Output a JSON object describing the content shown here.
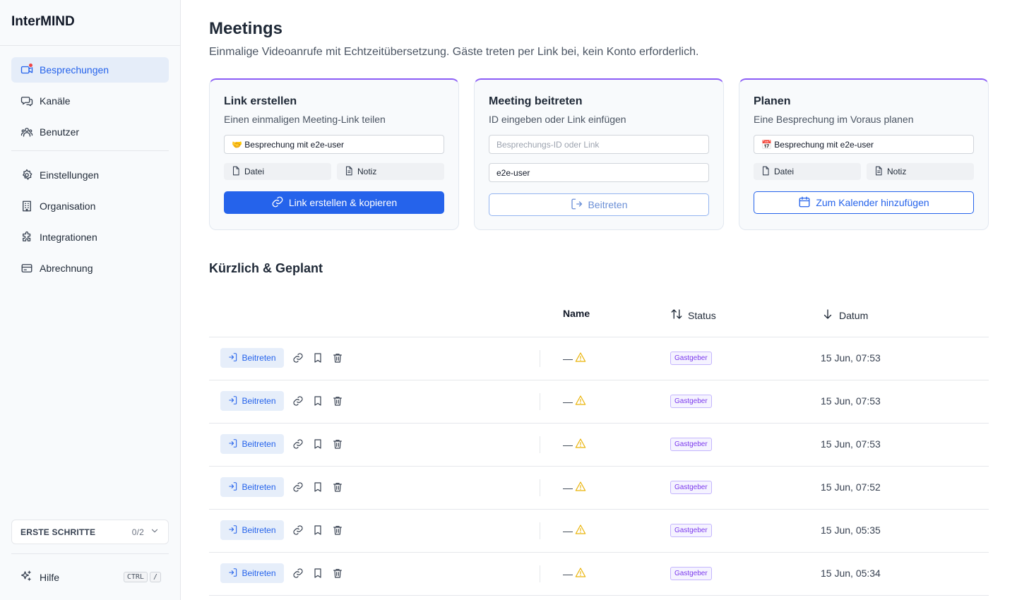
{
  "app": {
    "name": "InterMIND"
  },
  "sidebar": {
    "primary": [
      {
        "label": "Besprechungen",
        "icon": "video-camera-icon",
        "active": true,
        "badge_color": "#ef4444"
      },
      {
        "label": "Kanäle",
        "icon": "chat-bubbles-icon"
      },
      {
        "label": "Benutzer",
        "icon": "users-icon"
      }
    ],
    "secondary": [
      {
        "label": "Einstellungen",
        "icon": "gear-icon"
      },
      {
        "label": "Organisation",
        "icon": "building-icon"
      },
      {
        "label": "Integrationen",
        "icon": "puzzle-icon"
      },
      {
        "label": "Abrechnung",
        "icon": "credit-card-icon"
      }
    ],
    "onboarding": {
      "label": "ERSTE SCHRITTE",
      "progress": "0/2"
    },
    "help": {
      "label": "Hilfe",
      "shortcut_key1": "CTRL",
      "shortcut_key2": "/"
    }
  },
  "page": {
    "title": "Meetings",
    "subtitle": "Einmalige Videoanrufe mit Echtzeitübersetzung. Gäste treten per Link bei, kein Konto erforderlich."
  },
  "cards": {
    "create": {
      "title": "Link erstellen",
      "subtitle": "Einen einmaligen Meeting-Link teilen",
      "name_value": "🤝 Besprechung mit e2e-user",
      "attach_file": "Datei",
      "attach_note": "Notiz",
      "button": "Link erstellen & kopieren"
    },
    "join": {
      "title": "Meeting beitreten",
      "subtitle": "ID eingeben oder Link einfügen",
      "id_placeholder": "Besprechungs-ID oder Link",
      "name_value": "e2e-user",
      "button": "Beitreten"
    },
    "schedule": {
      "title": "Planen",
      "subtitle": "Eine Besprechung im Voraus planen",
      "name_value": "📅 Besprechung mit e2e-user",
      "attach_file": "Datei",
      "attach_note": "Notiz",
      "button": "Zum Kalender hinzufügen"
    }
  },
  "recent": {
    "title": "Kürzlich & Geplant",
    "columns": {
      "name": "Name",
      "status": "Status",
      "date": "Datum"
    },
    "rows": [
      {
        "join": "Beitreten",
        "name": "—",
        "status": "Gastgeber",
        "date": "15 Jun, 07:53"
      },
      {
        "join": "Beitreten",
        "name": "—",
        "status": "Gastgeber",
        "date": "15 Jun, 07:53"
      },
      {
        "join": "Beitreten",
        "name": "—",
        "status": "Gastgeber",
        "date": "15 Jun, 07:53"
      },
      {
        "join": "Beitreten",
        "name": "—",
        "status": "Gastgeber",
        "date": "15 Jun, 07:52"
      },
      {
        "join": "Beitreten",
        "name": "—",
        "status": "Gastgeber",
        "date": "15 Jun, 05:35"
      },
      {
        "join": "Beitreten",
        "name": "—",
        "status": "Gastgeber",
        "date": "15 Jun, 05:34"
      }
    ]
  },
  "colors": {
    "accent": "#2563eb",
    "card_top": "#8b5cf6",
    "warning": "#eab308",
    "badge": "#7c3aed"
  }
}
